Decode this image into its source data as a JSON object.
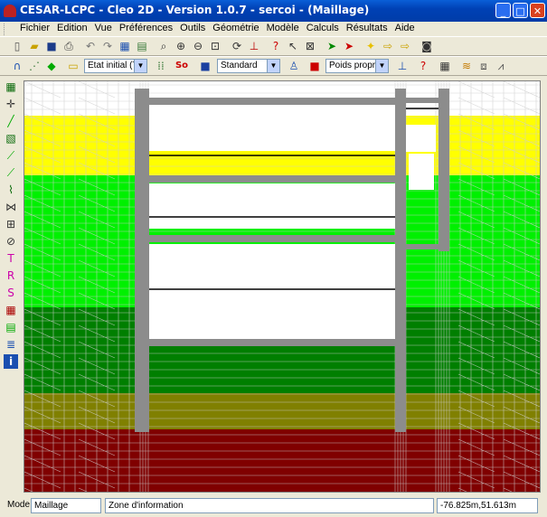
{
  "window": {
    "title": "CESAR-LCPC - Cleo 2D - Version 1.0.7 - sercoi - (Maillage)"
  },
  "window_buttons": {
    "minimize": "_",
    "maximize": "□",
    "close": "✕"
  },
  "menu": [
    "Fichier",
    "Edition",
    "Vue",
    "Préférences",
    "Outils",
    "Géométrie",
    "Modèle",
    "Calculs",
    "Résultats",
    "Aide"
  ],
  "toolbar2": {
    "phase_combo": "Etat initial (TCN",
    "group_combo": "Standard",
    "load_combo": "Poids propre",
    "so_label": "So"
  },
  "status": {
    "mode_label": "Mode :",
    "mode_value": "Maillage",
    "info": "Zone d'information",
    "coords": "-76.825m,51.613m"
  },
  "colors": {
    "layer_white": "#ffffff",
    "layer_yellow": "#ffff00",
    "layer_light_green": "#00f000",
    "layer_dark_green": "#007f00",
    "layer_olive": "#808000",
    "layer_maroon": "#800000",
    "wall": "#8c8c8c",
    "mesh_line": "#cfcfcf"
  },
  "icons": {
    "toolbar1": [
      "new-file-icon",
      "open-folder-icon",
      "save-icon",
      "print-icon",
      "undo-icon",
      "redo-icon",
      "mesh-view-icon",
      "layers-icon",
      "zoom-icon",
      "zoom-in-icon",
      "zoom-out-icon",
      "zoom-fit-icon",
      "rotate-icon",
      "scale-icon",
      "help-icon",
      "pointer-icon",
      "select-node-icon",
      "select-element-icon",
      "arrow-select-icon",
      "arrow-select-2-icon",
      "light-icon",
      "move-icon",
      "move-2-icon",
      "camera-icon"
    ],
    "toolbar2": [
      "arch-icon",
      "dotted-line-icon",
      "diamond-icon",
      "note-icon",
      "grid-icon",
      "color-square-icon",
      "person-icon",
      "book-icon",
      "anchor-icon",
      "help-box-icon",
      "calculator-icon",
      "stack-icon",
      "mesh-icon",
      "chart-icon"
    ],
    "sidebar": [
      "grid-icon",
      "node-icon",
      "line-icon",
      "region-icon",
      "segment-icon",
      "segment-2-icon",
      "lasso-icon",
      "element-icon",
      "mesh-block-icon",
      "clip-icon",
      "text-icon",
      "rotate-icon",
      "s-z-icon",
      "grid-2-icon",
      "assign-icon",
      "layers-icon",
      "info-icon"
    ]
  }
}
